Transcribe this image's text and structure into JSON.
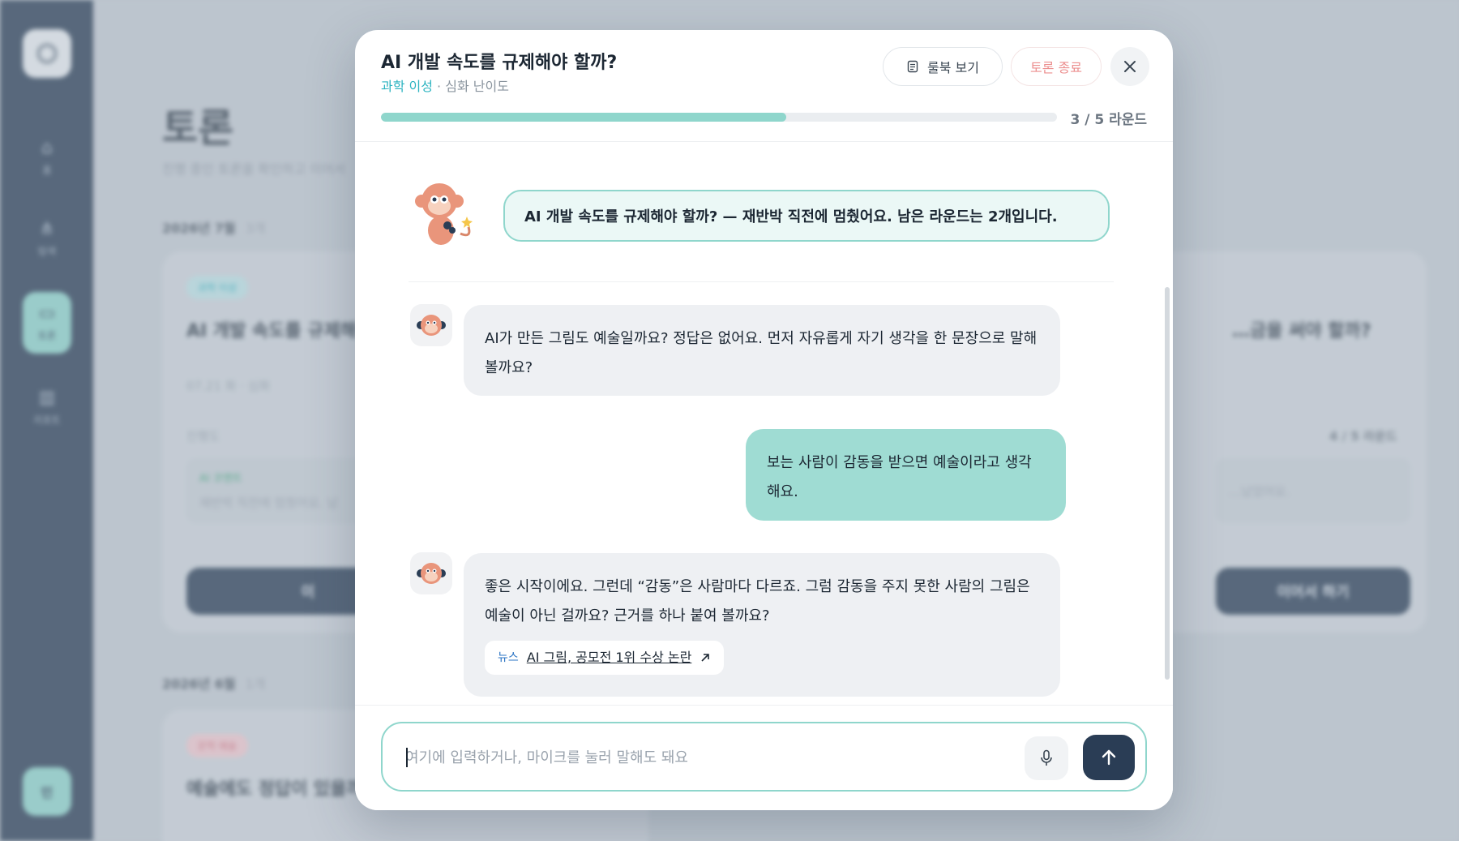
{
  "background": {
    "sidebar": {
      "items": [
        {
          "label": "홈",
          "icon": "home-icon"
        },
        {
          "label": "탐색",
          "icon": "share-icon"
        },
        {
          "label": "토론",
          "icon": "chat-icon"
        },
        {
          "label": "리포트",
          "icon": "chart-icon"
        }
      ],
      "user_initial": "민"
    },
    "page_title": "토론",
    "page_subtitle": "진행 중인 토론을 확인하고 이어서",
    "months": [
      {
        "label": "2026년 7월",
        "count": "3개"
      },
      {
        "label": "2026년 6월",
        "count": "1개"
      }
    ],
    "cards": [
      {
        "tag": "과학 이성",
        "title": "AI 개발 속도를 규제해야",
        "meta": "07.21 화 · 심화",
        "progress_label": "진행도",
        "box_label": "AI 코멘트",
        "box_text": "재반박 직전에 멈췄어요. 남",
        "button": "이"
      },
      {
        "title": "…금을 써야 할까?",
        "round": "4 / 5 라운드",
        "box_text": "…났었어요.",
        "button": "이어서 하기"
      },
      {
        "tag": "문학 예술",
        "title": "예술에도 정답이 있을까"
      }
    ]
  },
  "modal": {
    "title": "AI 개발 속도를 규제해야 할까?",
    "subject": "과학 이성",
    "separator": " · ",
    "difficulty": "심화 난이도",
    "rulebook_label": "룰북 보기",
    "end_label": "토론 종료",
    "progress": {
      "current": 3,
      "total": 5,
      "fraction": 0.6,
      "label": "3 / 5 라운드"
    },
    "intro_message": "AI 개발 속도를 규제해야 할까? — 재반박 직전에 멈췄어요. 남은 라운드는 2개입니다.",
    "messages": [
      {
        "role": "ai",
        "text": "AI가 만든 그림도 예술일까요? 정답은 없어요. 먼저 자유롭게 자기 생각을 한 문장으로 말해 볼까요?"
      },
      {
        "role": "user",
        "text": "보는 사람이 감동을 받으면 예술이라고 생각해요."
      },
      {
        "role": "ai",
        "text": "좋은 시작이에요. 그런데 “감동”은 사람마다 다르죠. 그럼 감동을 주지 못한 사람의 그림은 예술이 아닌 걸까요? 근거를 하나 붙여 볼까요?",
        "news": {
          "label": "뉴스",
          "title": "AI 그림, 공모전 1위 수상 논란"
        }
      }
    ],
    "input": {
      "placeholder": "여기에 입력하거나, 마이크를 눌러 말해도 돼요",
      "value": ""
    },
    "colors": {
      "accent": "#8fd6cc",
      "navy": "#2a3d55",
      "subject": "#2bb3c0",
      "danger": "#ec8f8f"
    }
  }
}
